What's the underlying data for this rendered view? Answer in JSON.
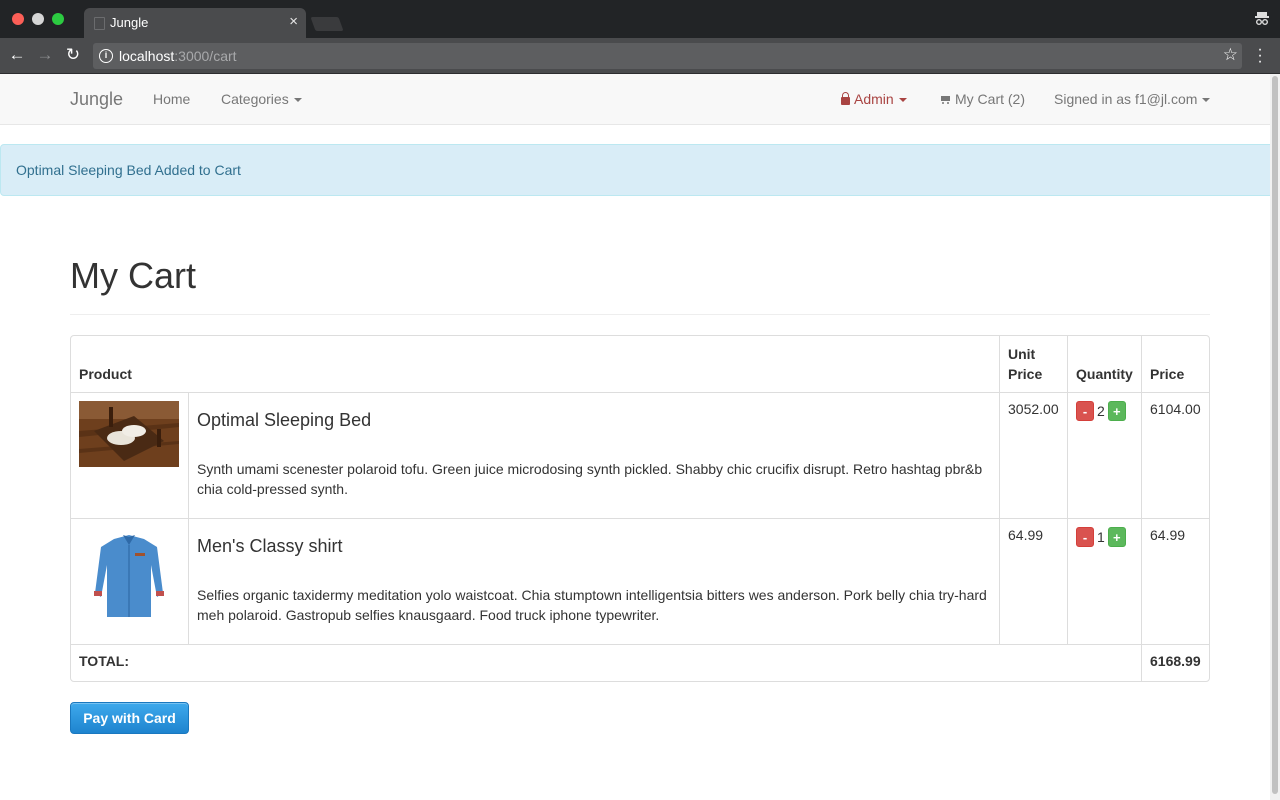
{
  "browser": {
    "tab_title": "Jungle",
    "url_host": "localhost",
    "url_path": ":3000/cart"
  },
  "navbar": {
    "brand": "Jungle",
    "home": "Home",
    "categories": "Categories",
    "admin": "Admin",
    "cart": "My Cart (2)",
    "signed_in": "Signed in as f1@jl.com"
  },
  "alert": {
    "message": "Optimal Sleeping Bed Added to Cart"
  },
  "page": {
    "title": "My Cart",
    "pay_button": "Pay with Card"
  },
  "table": {
    "headers": {
      "product": "Product",
      "unit_price": "Unit Price",
      "quantity": "Quantity",
      "price": "Price"
    },
    "items": [
      {
        "name": "Optimal Sleeping Bed",
        "description": "Synth umami scenester polaroid tofu. Green juice microdosing synth pickled. Shabby chic crucifix disrupt. Retro hashtag pbr&b chia cold-pressed synth.",
        "unit_price": "3052.00",
        "quantity": "2",
        "price": "6104.00",
        "minus": "-",
        "plus": "+"
      },
      {
        "name": "Men's Classy shirt",
        "description": "Selfies organic taxidermy meditation yolo waistcoat. Chia stumptown intelligentsia bitters wes anderson. Pork belly chia try-hard meh polaroid. Gastropub selfies knausgaard. Food truck iphone typewriter.",
        "unit_price": "64.99",
        "quantity": "1",
        "price": "64.99",
        "minus": "-",
        "plus": "+"
      }
    ],
    "total_label": "TOTAL:",
    "total_value": "6168.99"
  },
  "colors": {
    "alert_bg": "#d9edf7",
    "admin": "#a94442",
    "minus": "#d9534f",
    "plus": "#5cb85c",
    "pay": "#1e84cf"
  }
}
